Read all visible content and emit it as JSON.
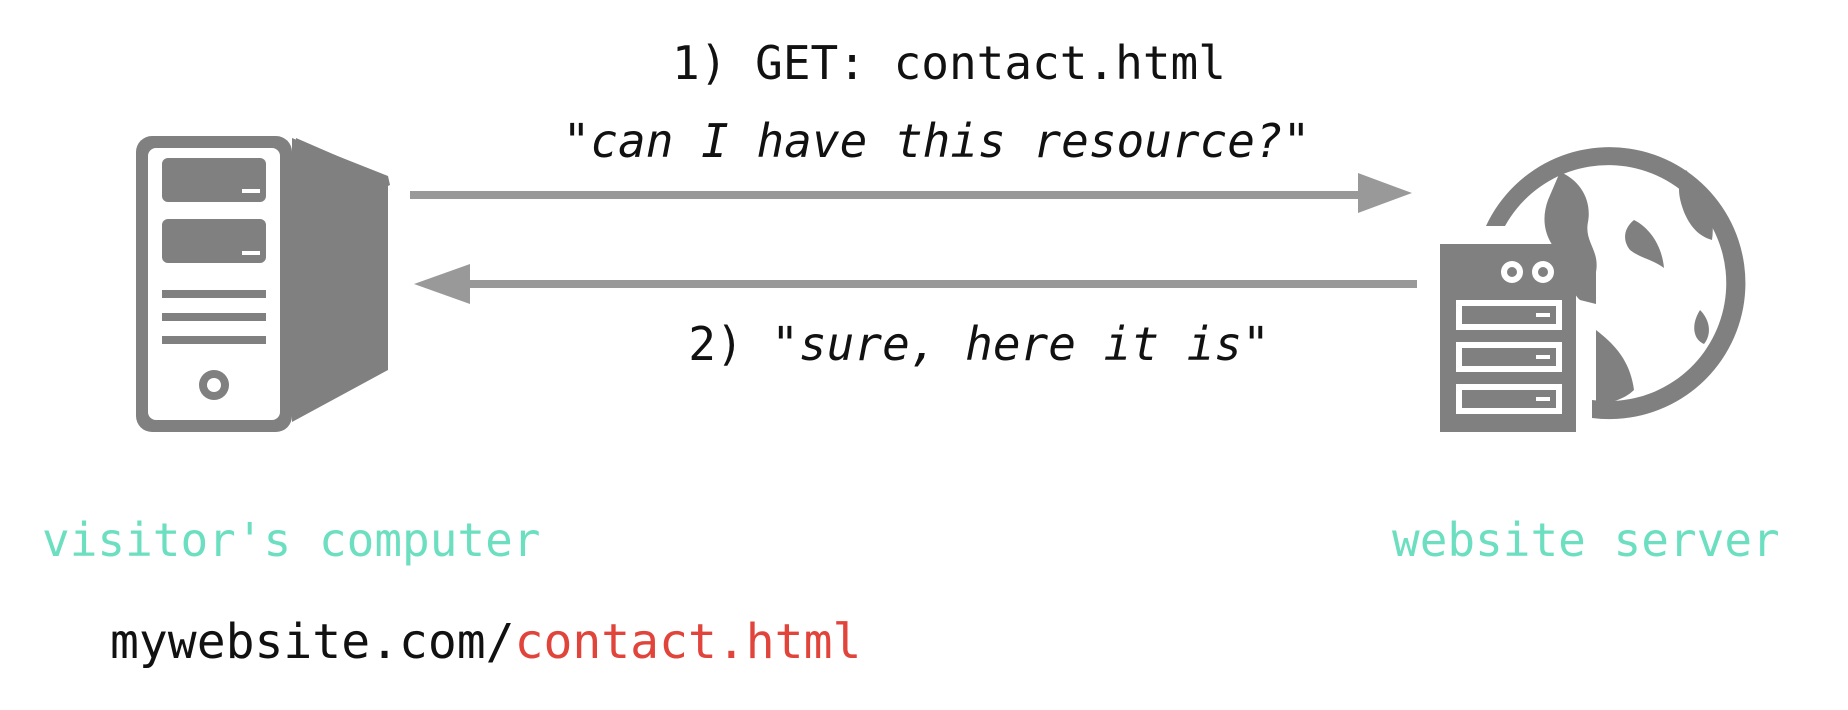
{
  "request": {
    "step_label": "1) GET: contact.html",
    "quote": "\"can I have this resource?\""
  },
  "response": {
    "step_prefix": "2) ",
    "quote": "\"sure, here it is\""
  },
  "labels": {
    "visitor": "visitor's computer",
    "server": "website server"
  },
  "url": {
    "host": "mywebsite.com/",
    "path": "contact.html"
  },
  "colors": {
    "icon_gray": "#808080",
    "arrow_gray": "#999999",
    "label_teal": "#6ddfc1",
    "path_red": "#e0443a"
  },
  "icons": {
    "client": "desktop-computer-icon",
    "server": "web-server-globe-icon"
  }
}
